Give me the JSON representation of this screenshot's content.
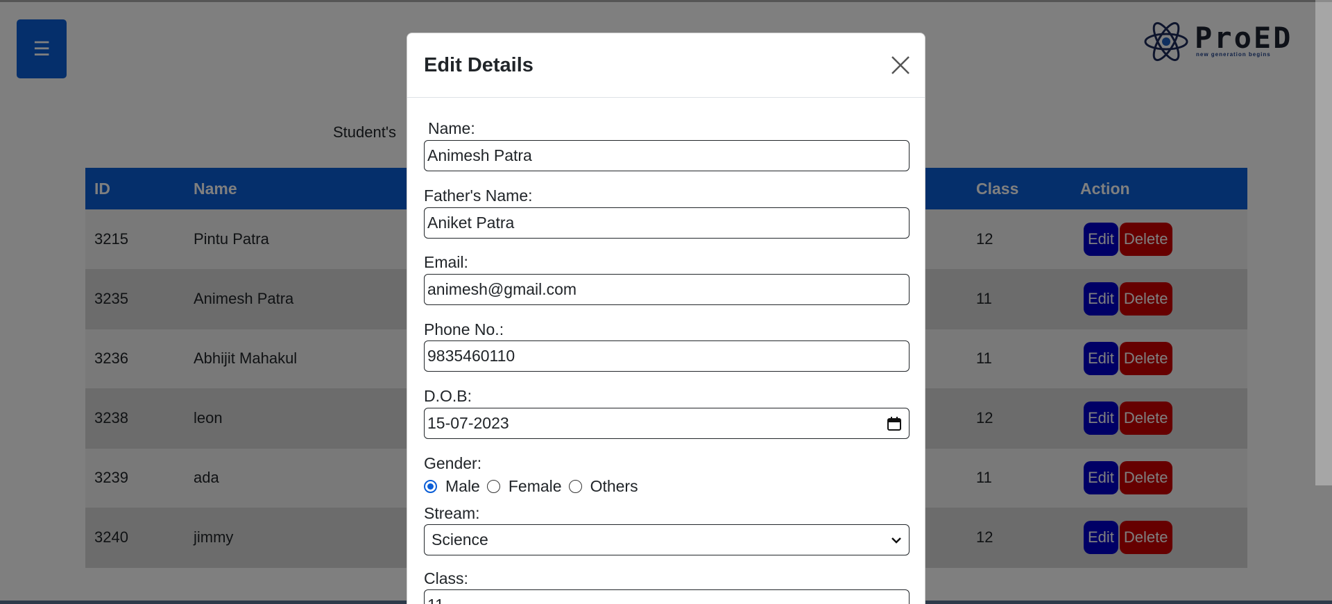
{
  "header": {
    "menu_icon": "☰",
    "logo_text": "ProED",
    "logo_tagline": "new generation begins"
  },
  "page": {
    "heading": "Student's"
  },
  "table": {
    "columns": [
      "ID",
      "Name",
      "Class",
      "Action"
    ],
    "rows": [
      {
        "id": "3215",
        "name": "Pintu Patra",
        "class": "12"
      },
      {
        "id": "3235",
        "name": "Animesh Patra",
        "class": "11"
      },
      {
        "id": "3236",
        "name": "Abhijit Mahakul",
        "class": "11"
      },
      {
        "id": "3238",
        "name": "leon",
        "class": "12"
      },
      {
        "id": "3239",
        "name": "ada",
        "class": "11"
      },
      {
        "id": "3240",
        "name": "jimmy",
        "class": "12"
      }
    ],
    "edit_label": "Edit",
    "delete_label": "Delete"
  },
  "modal": {
    "title": "Edit Details",
    "close_icon": "close-icon",
    "name_label": "Name:",
    "name_value": "Animesh Patra",
    "father_label": "Father's Name:",
    "father_value": "Aniket Patra",
    "email_label": "Email:",
    "email_value": "animesh@gmail.com",
    "phone_label": "Phone No.:",
    "phone_value": "9835460110",
    "dob_label": "D.O.B:",
    "dob_value": "15-07-2023",
    "gender_label": "Gender:",
    "gender_options": [
      "Male",
      "Female",
      "Others"
    ],
    "gender_selected": "Male",
    "stream_label": "Stream:",
    "stream_value": "Science",
    "class_label": "Class:",
    "class_value": "11"
  },
  "colors": {
    "primary": "#0b5ed7",
    "edit": "#0000cc",
    "delete": "#cc0000"
  }
}
